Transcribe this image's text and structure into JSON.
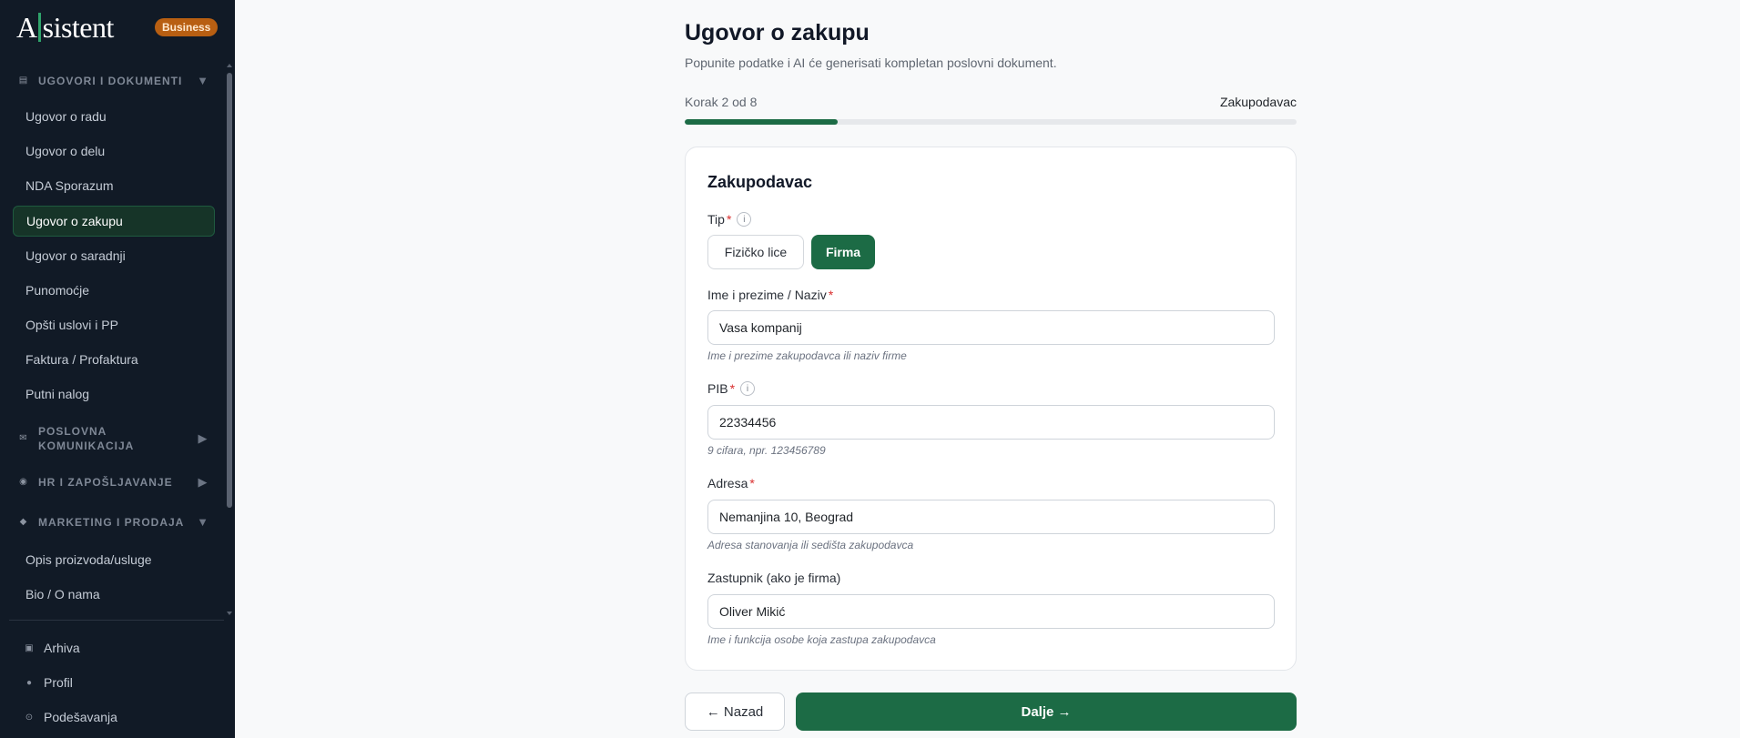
{
  "brand": {
    "logo_a": "A",
    "logo_rest": "sistent",
    "badge": "Business"
  },
  "sidebar": {
    "sections": {
      "ugovori": {
        "icon": "document-stack-icon",
        "label": "Ugovori i dokumenti",
        "state": "expanded"
      },
      "poslovna": {
        "icon": "mail-icon",
        "label": "Poslovna komunikacija",
        "state": "collapsed"
      },
      "hr": {
        "icon": "people-icon",
        "label": "HR i zapošljavanje",
        "state": "collapsed"
      },
      "marketing": {
        "icon": "diamond-icon",
        "label": "Marketing i prodaja",
        "state": "expanded"
      }
    },
    "ugovori_items": [
      {
        "label": "Ugovor o radu"
      },
      {
        "label": "Ugovor o delu"
      },
      {
        "label": "NDA Sporazum"
      },
      {
        "label": "Ugovor o zakupu",
        "active": true
      },
      {
        "label": "Ugovor o saradnji"
      },
      {
        "label": "Punomoćje"
      },
      {
        "label": "Opšti uslovi i PP"
      },
      {
        "label": "Faktura / Profaktura"
      },
      {
        "label": "Putni nalog"
      }
    ],
    "marketing_items": [
      {
        "label": "Opis proizvoda/usluge"
      },
      {
        "label": "Bio / O nama"
      }
    ],
    "footer": [
      {
        "icon": "archive-icon",
        "label": "Arhiva"
      },
      {
        "icon": "profile-dot-icon",
        "label": "Profil"
      },
      {
        "icon": "settings-icon",
        "label": "Podešavanja"
      }
    ]
  },
  "page": {
    "title": "Ugovor o zakupu",
    "subtitle": "Popunite podatke i AI će generisati kompletan poslovni dokument.",
    "step_text": "Korak 2 od 8",
    "step_name": "Zakupodavac",
    "progress_fraction": 0.25
  },
  "form": {
    "section_title": "Zakupodavac",
    "tip": {
      "label": "Tip",
      "required": "*",
      "info": "i",
      "options": [
        "Fizičko lice",
        "Firma"
      ],
      "selected": "Firma"
    },
    "name": {
      "label": "Ime i prezime / Naziv",
      "required": "*",
      "value": "Vasa kompanij",
      "hint": "Ime i prezime zakupodavca ili naziv firme"
    },
    "pib": {
      "label": "PIB",
      "required": "*",
      "info": "i",
      "value": "22334456",
      "hint": "9 cifara, npr. 123456789"
    },
    "address": {
      "label": "Adresa",
      "required": "*",
      "value": "Nemanjina 10, Beograd",
      "hint": "Adresa stanovanja ili sedišta zakupodavca"
    },
    "rep": {
      "label": "Zastupnik (ako je firma)",
      "value": "Oliver Mikić",
      "hint": "Ime i funkcija osobe koja zastupa zakupodavca"
    }
  },
  "actions": {
    "back": "← Nazad",
    "next": "Dalje →"
  },
  "colors": {
    "sidebar_bg": "#111a26",
    "accent": "#1c6b45",
    "badge": "#b85f12",
    "required": "#d92d2d"
  }
}
